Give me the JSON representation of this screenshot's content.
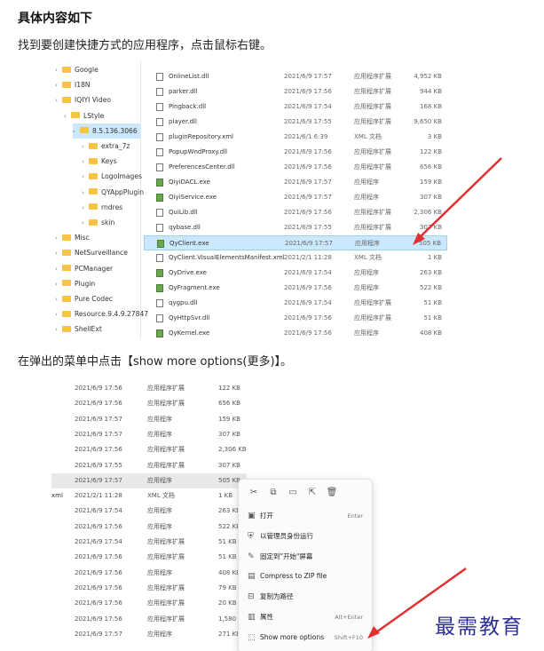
{
  "heading": "具体内容如下",
  "para1": "找到要创建快捷方式的应用程序，点击鼠标右键。",
  "para2": "在弹出的菜单中点击【show more options(更多)】。",
  "watermark": "最需教育",
  "colors": {
    "selection": "#cce8ff",
    "arrow": "#e03030",
    "folder": "#f6c342",
    "watermark": "#2e3192"
  },
  "tree": [
    {
      "label": "Google",
      "depth": 0
    },
    {
      "label": "I18N",
      "depth": 0
    },
    {
      "label": "IQIYI Video",
      "depth": 0
    },
    {
      "label": "LStyle",
      "depth": 1
    },
    {
      "label": "8.5.136.3066",
      "depth": 2,
      "selected": true
    },
    {
      "label": "extra_7z",
      "depth": 3
    },
    {
      "label": "Keys",
      "depth": 3
    },
    {
      "label": "LogoImages",
      "depth": 3
    },
    {
      "label": "QYAppPlugin",
      "depth": 3
    },
    {
      "label": "rndres",
      "depth": 3
    },
    {
      "label": "skin",
      "depth": 3
    },
    {
      "label": "Misc",
      "depth": 0
    },
    {
      "label": "NetSurveillance",
      "depth": 0
    },
    {
      "label": "PCManager",
      "depth": 0
    },
    {
      "label": "Plugin",
      "depth": 0
    },
    {
      "label": "Pure Codec",
      "depth": 0
    },
    {
      "label": "Resource.9.4.9.27847",
      "depth": 0
    },
    {
      "label": "ShellExt",
      "depth": 0
    }
  ],
  "files": [
    {
      "name": "OnlineList.dll",
      "date": "2021/6/9 17:57",
      "type": "应用程序扩展",
      "size": "4,952 KB"
    },
    {
      "name": "parker.dll",
      "date": "2021/6/9 17:56",
      "type": "应用程序扩展",
      "size": "944 KB"
    },
    {
      "name": "Pingback.dll",
      "date": "2021/6/9 17:54",
      "type": "应用程序扩展",
      "size": "168 KB"
    },
    {
      "name": "player.dll",
      "date": "2021/6/9 17:55",
      "type": "应用程序扩展",
      "size": "9,650 KB"
    },
    {
      "name": "pluginRepository.xml",
      "date": "2021/6/1 6:39",
      "type": "XML 文档",
      "size": "3 KB"
    },
    {
      "name": "PopupWndProxy.dll",
      "date": "2021/6/9 17:56",
      "type": "应用程序扩展",
      "size": "122 KB"
    },
    {
      "name": "PreferencesCenter.dll",
      "date": "2021/6/9 17:56",
      "type": "应用程序扩展",
      "size": "656 KB"
    },
    {
      "name": "QiyiDACL.exe",
      "date": "2021/6/9 17:57",
      "type": "应用程序",
      "size": "159 KB"
    },
    {
      "name": "QiyiService.exe",
      "date": "2021/6/9 17:57",
      "type": "应用程序",
      "size": "307 KB"
    },
    {
      "name": "QuiLib.dll",
      "date": "2021/6/9 17:56",
      "type": "应用程序扩展",
      "size": "2,306 KB"
    },
    {
      "name": "qybase.dll",
      "date": "2021/6/9 17:55",
      "type": "应用程序扩展",
      "size": "307 KB"
    },
    {
      "name": "QyClient.exe",
      "date": "2021/6/9 17:57",
      "type": "应用程序",
      "size": "505 KB",
      "highlight": true
    },
    {
      "name": "QyClient.VisualElementsManifest.xml",
      "date": "2021/2/1 11:28",
      "type": "XML 文档",
      "size": "1 KB"
    },
    {
      "name": "QyDrive.exe",
      "date": "2021/6/9 17:54",
      "type": "应用程序",
      "size": "263 KB"
    },
    {
      "name": "QyFragment.exe",
      "date": "2021/6/9 17:56",
      "type": "应用程序",
      "size": "522 KB"
    },
    {
      "name": "qygpu.dll",
      "date": "2021/6/9 17:54",
      "type": "应用程序扩展",
      "size": "51 KB"
    },
    {
      "name": "QyHttpSvr.dll",
      "date": "2021/6/9 17:56",
      "type": "应用程序扩展",
      "size": "51 KB"
    },
    {
      "name": "QyKernel.exe",
      "date": "2021/6/9 17:56",
      "type": "应用程序",
      "size": "408 KB"
    }
  ],
  "list2": [
    {
      "name": "",
      "date": "2021/6/9 17:56",
      "type": "应用程序扩展",
      "size": "122 KB"
    },
    {
      "name": "",
      "date": "2021/6/9 17:56",
      "type": "应用程序扩展",
      "size": "656 KB"
    },
    {
      "name": "",
      "date": "2021/6/9 17:57",
      "type": "应用程序",
      "size": "159 KB"
    },
    {
      "name": "",
      "date": "2021/6/9 17:57",
      "type": "应用程序",
      "size": "307 KB"
    },
    {
      "name": "",
      "date": "2021/6/9 17:56",
      "type": "应用程序扩展",
      "size": "2,306 KB"
    },
    {
      "name": "",
      "date": "2021/6/9 17:55",
      "type": "应用程序扩展",
      "size": "307 KB"
    },
    {
      "name": "",
      "date": "2021/6/9 17:57",
      "type": "应用程序",
      "size": "505 KB",
      "highlight": true
    },
    {
      "name": "xml",
      "date": "2021/2/1 11:28",
      "type": "XML 文档",
      "size": "1 KB"
    },
    {
      "name": "",
      "date": "2021/6/9 17:54",
      "type": "应用程序",
      "size": "263 KB"
    },
    {
      "name": "",
      "date": "2021/6/9 17:56",
      "type": "应用程序",
      "size": "522 KB"
    },
    {
      "name": "",
      "date": "2021/6/9 17:54",
      "type": "应用程序扩展",
      "size": "51 KB"
    },
    {
      "name": "",
      "date": "2021/6/9 17:56",
      "type": "应用程序扩展",
      "size": "51 KB"
    },
    {
      "name": "",
      "date": "2021/6/9 17:56",
      "type": "应用程序",
      "size": "408 KB"
    },
    {
      "name": "",
      "date": "2021/6/9 17:56",
      "type": "应用程序扩展",
      "size": "79 KB"
    },
    {
      "name": "",
      "date": "2021/6/9 17:56",
      "type": "应用程序扩展",
      "size": "20 KB"
    },
    {
      "name": "",
      "date": "2021/6/9 17:56",
      "type": "应用程序扩展",
      "size": "1,580 KB"
    },
    {
      "name": "",
      "date": "2021/6/9 17:57",
      "type": "应用程序",
      "size": "271 KB"
    }
  ],
  "menu": {
    "tools": [
      {
        "icon": "cut-icon",
        "glyph": "✂"
      },
      {
        "icon": "copy-icon",
        "glyph": "⧉"
      },
      {
        "icon": "rename-icon",
        "glyph": "▭"
      },
      {
        "icon": "share-icon",
        "glyph": "⇱"
      },
      {
        "icon": "delete-icon",
        "glyph": "🗑"
      }
    ],
    "items": [
      {
        "icon": "open-icon",
        "glyph": "▣",
        "label": "打开",
        "shortcut": "Enter"
      },
      {
        "icon": "shield-icon",
        "glyph": "⛨",
        "label": "以管理员身份运行",
        "shortcut": ""
      },
      {
        "icon": "pin-icon",
        "glyph": "✎",
        "label": "固定到\"开始\"屏幕",
        "shortcut": ""
      },
      {
        "icon": "zip-icon",
        "glyph": "▤",
        "label": "Compress to ZIP file",
        "shortcut": ""
      },
      {
        "icon": "path-icon",
        "glyph": "⊟",
        "label": "复制为路径",
        "shortcut": ""
      },
      {
        "icon": "properties-icon",
        "glyph": "▥",
        "label": "属性",
        "shortcut": "Alt+Enter"
      },
      {
        "icon": "more-options-icon",
        "glyph": "⬚",
        "label": "Show more options",
        "shortcut": "Shift+F10"
      }
    ]
  }
}
